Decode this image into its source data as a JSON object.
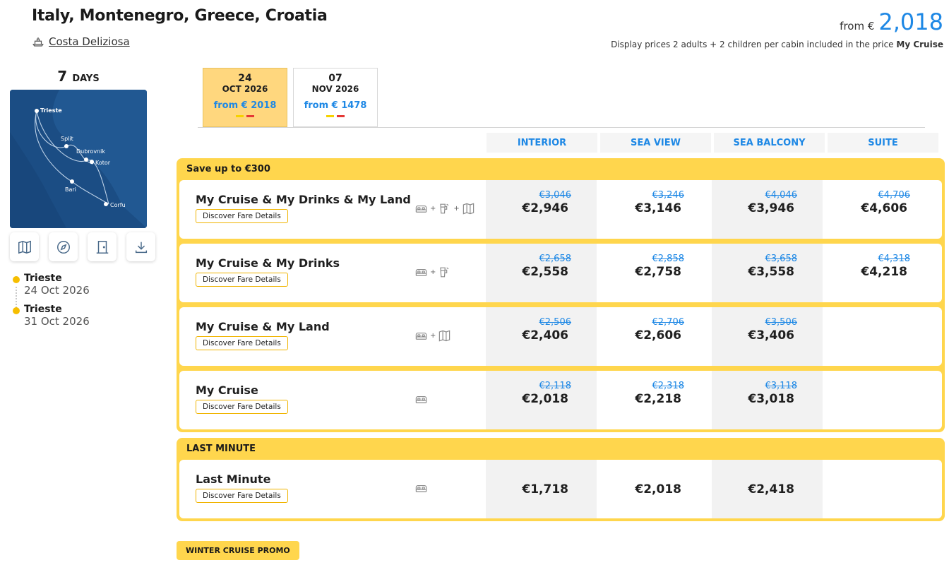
{
  "header": {
    "title": "Italy, Montenegro, Greece, Croatia",
    "ship_name": "Costa Deliziosa",
    "from_label": "from €",
    "from_value": "2,018",
    "display_note": "Display prices 2 adults + 2 children per cabin included in the price",
    "display_note_bold": "My Cruise"
  },
  "sidebar": {
    "days_num": "7",
    "days_label": "DAYS",
    "map_ports": [
      "Trieste",
      "Split",
      "Dubrovnik",
      "Kotor",
      "Bari",
      "Corfu"
    ],
    "tools": [
      "map-icon",
      "compass-icon",
      "door-icon",
      "download-icon"
    ],
    "itinerary": [
      {
        "city": "Trieste",
        "date": "24 Oct 2026"
      },
      {
        "city": "Trieste",
        "date": "31 Oct 2026"
      }
    ]
  },
  "date_tabs": [
    {
      "day": "24",
      "month": "OCT 2026",
      "from": "from € 2018",
      "active": true
    },
    {
      "day": "07",
      "month": "NOV 2026",
      "from": "from € 1478",
      "active": false
    }
  ],
  "flag_colors": {
    "yellow": "#f6d200",
    "red": "#e53935"
  },
  "columns": [
    "INTERIOR",
    "SEA VIEW",
    "SEA BALCONY",
    "SUITE"
  ],
  "groups": [
    {
      "title": "Save up to €300",
      "rows": [
        {
          "name": "My Cruise & My Drinks & My Land",
          "button": "Discover Fare Details",
          "icons": [
            "cabin-icon",
            "drink-icon",
            "land-map-icon"
          ],
          "prices": [
            {
              "old": "€3,046",
              "new": "€2,946"
            },
            {
              "old": "€3,246",
              "new": "€3,146"
            },
            {
              "old": "€4,046",
              "new": "€3,946"
            },
            {
              "old": "€4,706",
              "new": "€4,606"
            }
          ]
        },
        {
          "name": "My Cruise & My Drinks",
          "button": "Discover Fare Details",
          "icons": [
            "cabin-icon",
            "drink-icon"
          ],
          "prices": [
            {
              "old": "€2,658",
              "new": "€2,558"
            },
            {
              "old": "€2,858",
              "new": "€2,758"
            },
            {
              "old": "€3,658",
              "new": "€3,558"
            },
            {
              "old": "€4,318",
              "new": "€4,218"
            }
          ]
        },
        {
          "name": "My Cruise & My Land",
          "button": "Discover Fare Details",
          "icons": [
            "cabin-icon",
            "land-map-icon"
          ],
          "prices": [
            {
              "old": "€2,506",
              "new": "€2,406"
            },
            {
              "old": "€2,706",
              "new": "€2,606"
            },
            {
              "old": "€3,506",
              "new": "€3,406"
            },
            null
          ]
        },
        {
          "name": "My Cruise",
          "button": "Discover Fare Details",
          "icons": [
            "cabin-icon"
          ],
          "prices": [
            {
              "old": "€2,118",
              "new": "€2,018"
            },
            {
              "old": "€2,318",
              "new": "€2,218"
            },
            {
              "old": "€3,118",
              "new": "€3,018"
            },
            null
          ]
        }
      ]
    },
    {
      "title": "LAST MINUTE",
      "rows": [
        {
          "name": "Last Minute",
          "button": "Discover Fare Details",
          "icons": [
            "cabin-icon"
          ],
          "prices": [
            {
              "old": "",
              "new": "€1,718"
            },
            {
              "old": "",
              "new": "€2,018"
            },
            {
              "old": "",
              "new": "€2,418"
            },
            null
          ]
        }
      ]
    }
  ],
  "promo_badge": "WINTER CRUISE PROMO"
}
